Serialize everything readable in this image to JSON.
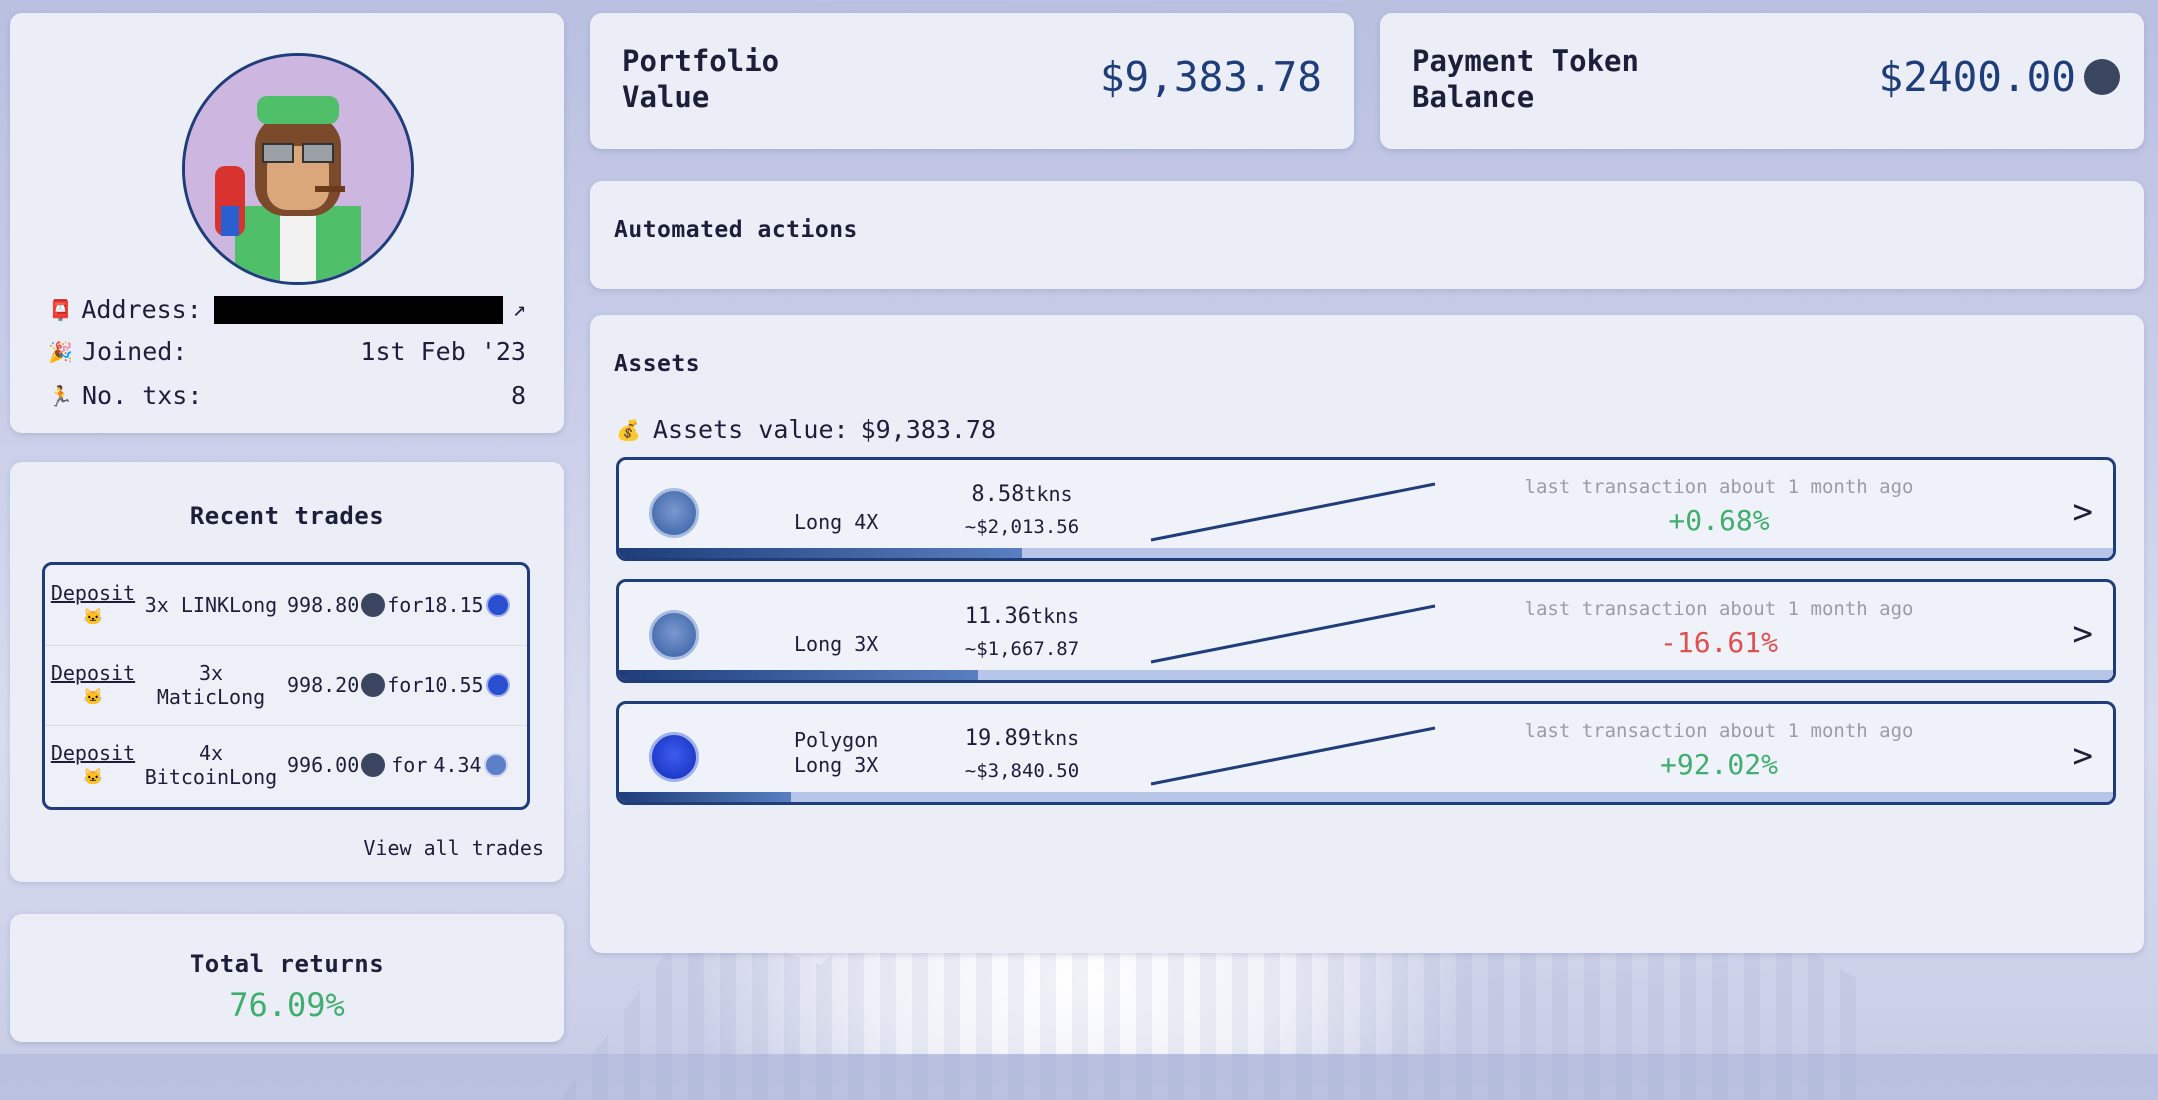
{
  "profile": {
    "address_label": "Address:",
    "joined_label": "Joined:",
    "joined_value": "1st Feb '23",
    "txs_label": "No. txs:",
    "txs_value": "8"
  },
  "recent_trades": {
    "title": "Recent trades",
    "trades": [
      {
        "type": "Deposit",
        "name": "3x LINKLong",
        "amount": "998.80",
        "for_label": "for",
        "received": "18.15"
      },
      {
        "type": "Deposit",
        "name": "3x MaticLong",
        "amount": "998.20",
        "for_label": "for",
        "received": "10.55"
      },
      {
        "type": "Deposit",
        "name": "4x BitcoinLong",
        "amount": "996.00",
        "for_label": "for",
        "received": "4.34"
      }
    ],
    "view_all": "View all trades"
  },
  "total_returns": {
    "title": "Total returns",
    "value": "76.09%"
  },
  "portfolio": {
    "label": "Portfolio Value",
    "value": "$9,383.78"
  },
  "payment_token": {
    "label": "Payment Token Balance",
    "value": "$2400.00"
  },
  "automated_actions": {
    "title": "Automated actions"
  },
  "assets": {
    "title": "Assets",
    "value_label": "Assets value:",
    "value": "$9,383.78",
    "items": [
      {
        "name": "Long 4X",
        "qty": "8.58",
        "unit": "tkns",
        "usd": "~$2,013.56",
        "last_tx": "last transaction about 1 month ago",
        "change": "+0.68%",
        "positive": true,
        "fill": 0.27
      },
      {
        "name": "Long 3X",
        "qty": "11.36",
        "unit": "tkns",
        "usd": "~$1,667.87",
        "last_tx": "last transaction about 1 month ago",
        "change": "-16.61%",
        "positive": false,
        "fill": 0.24
      },
      {
        "name": "Polygon Long 3X",
        "qty": "19.89",
        "unit": "tkns",
        "usd": "~$3,840.50",
        "last_tx": "last transaction about 1 month ago",
        "change": "+92.02%",
        "positive": true,
        "fill": 0.115
      }
    ]
  },
  "colors": {
    "accent": "#1e3d7a",
    "positive": "#3fae6e",
    "negative": "#e05050",
    "card": "#eceef7"
  }
}
